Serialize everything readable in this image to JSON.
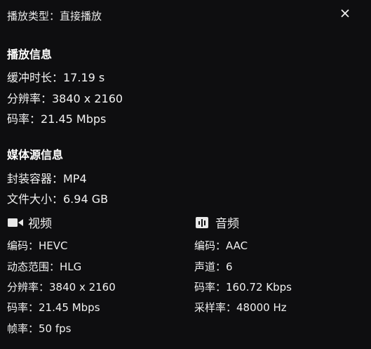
{
  "header": {
    "play_type": "播放类型：直接播放"
  },
  "icons": {
    "close": "close-icon",
    "video": "video-camera-icon",
    "audio": "audio-wave-icon"
  },
  "playback": {
    "title": "播放信息",
    "lines": [
      "缓冲时长：17.19 s",
      "分辨率：3840 x 2160",
      "码率：21.45 Mbps"
    ]
  },
  "media": {
    "title": "媒体源信息",
    "lines": [
      "封装容器：MP4",
      "文件大小：6.94 GB"
    ]
  },
  "video": {
    "title": "视频",
    "items": [
      "编码：HEVC",
      "动态范围：HLG",
      "分辨率：3840 x 2160",
      "码率：21.45 Mbps",
      "帧率：50 fps"
    ]
  },
  "audio": {
    "title": "音频",
    "items": [
      "编码：AAC",
      "声道：6",
      "码率：160.72 Kbps",
      "采样率：48000 Hz"
    ]
  }
}
